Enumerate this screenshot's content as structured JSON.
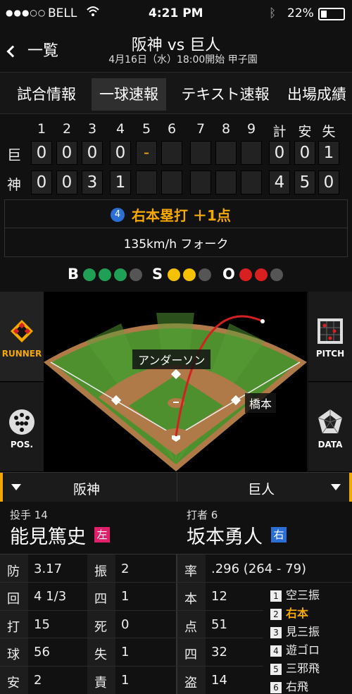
{
  "status_bar": {
    "carrier": "BELL",
    "time": "4:21 PM",
    "battery": "22%"
  },
  "nav": {
    "back_label": "一覧",
    "title": "阪神 vs 巨人",
    "subtitle": "4月16日（水）18:00開始 甲子園"
  },
  "tabs": [
    "試合情報",
    "一球速報",
    "テキスト速報",
    "出場成績"
  ],
  "scoreboard": {
    "innings": [
      "1",
      "2",
      "3",
      "4",
      "5",
      "6",
      "7",
      "8",
      "9"
    ],
    "totals_headers": [
      "計",
      "安",
      "失"
    ],
    "teams": [
      {
        "label": "巨",
        "scores": [
          "0",
          "0",
          "0",
          "0",
          "-",
          "",
          "",
          "",
          ""
        ],
        "totals": [
          "0",
          "0",
          "1"
        ]
      },
      {
        "label": "神",
        "scores": [
          "0",
          "0",
          "3",
          "1",
          "",
          "",
          "",
          "",
          ""
        ],
        "totals": [
          "4",
          "5",
          "0"
        ]
      }
    ]
  },
  "play": {
    "number": "4",
    "headline": "右本塁打 ＋1点",
    "pitch": "135km/h フォーク"
  },
  "count": {
    "b_label": "B",
    "s_label": "S",
    "o_label": "O",
    "balls": 3,
    "strikes": 2,
    "outs": 2
  },
  "field": {
    "fielder_center": "アンダーソン",
    "fielder_right": "橋本"
  },
  "side_buttons": {
    "runner": "RUNNER",
    "pos": "POS.",
    "pitch": "PITCH",
    "data": "DATA"
  },
  "teams": {
    "left": "阪神",
    "right": "巨人"
  },
  "pitcher": {
    "role": "投手 14",
    "name": "能見篤史",
    "hand": "左"
  },
  "batter": {
    "role": "打者 6",
    "name": "坂本勇人",
    "hand": "右"
  },
  "pitcher_stats": [
    {
      "l1": "防",
      "v1": "3.17",
      "l2": "振",
      "v2": "2"
    },
    {
      "l1": "回",
      "v1": "4 1/3",
      "l2": "四",
      "v2": "1"
    },
    {
      "l1": "打",
      "v1": "15",
      "l2": "死",
      "v2": "0"
    },
    {
      "l1": "球",
      "v1": "56",
      "l2": "失",
      "v2": "1"
    },
    {
      "l1": "安",
      "v1": "2",
      "l2": "責",
      "v2": "1"
    }
  ],
  "batter_stats": [
    {
      "l": "率",
      "v": ".296 (264 - 79)"
    },
    {
      "l": "本",
      "v": "12"
    },
    {
      "l": "点",
      "v": "51"
    },
    {
      "l": "四",
      "v": "32"
    },
    {
      "l": "盗",
      "v": "14"
    }
  ],
  "at_bat_log": [
    {
      "n": "1",
      "t": "空三振"
    },
    {
      "n": "2",
      "t": "右本"
    },
    {
      "n": "3",
      "t": "見三振"
    },
    {
      "n": "4",
      "t": "遊ゴロ"
    },
    {
      "n": "5",
      "t": "三邪飛"
    },
    {
      "n": "6",
      "t": "右飛"
    }
  ],
  "colors": {
    "accent": "#f4a800",
    "ball": "#1fa055",
    "strike": "#f4c000",
    "out": "#d92020",
    "play_badge": "#2a6fd6",
    "left_hand": "#e0206a",
    "right_hand": "#2a6fd6",
    "field_grass": "#4e8f2e",
    "field_dirt": "#b07a48"
  }
}
